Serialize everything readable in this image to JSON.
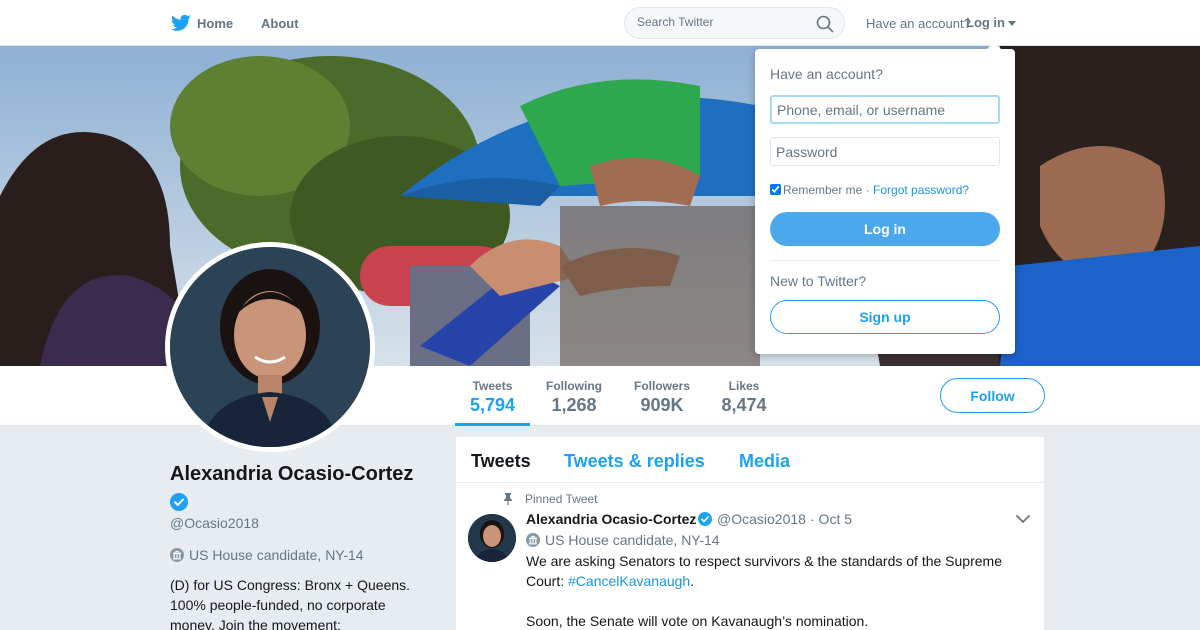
{
  "nav": {
    "home": "Home",
    "about": "About",
    "search_placeholder": "Search Twitter",
    "have_account": "Have an account?",
    "login": "Log in"
  },
  "stats": [
    {
      "label": "Tweets",
      "value": "5,794"
    },
    {
      "label": "Following",
      "value": "1,268"
    },
    {
      "label": "Followers",
      "value": "909K"
    },
    {
      "label": "Likes",
      "value": "8,474"
    }
  ],
  "follow_label": "Follow",
  "profile": {
    "name": "Alexandria Ocasio-Cortez",
    "handle": "@Ocasio2018",
    "location": "US House candidate, NY-14",
    "bio": "(D) for US Congress: Bronx + Queens. 100% people-funded, no corporate money. Join the movement:"
  },
  "tabs": [
    "Tweets",
    "Tweets & replies",
    "Media"
  ],
  "tweet": {
    "pinned_label": "Pinned Tweet",
    "name": "Alexandria Ocasio-Cortez",
    "handle": "@Ocasio2018",
    "date": "· Oct 5",
    "location": "US House candidate, NY-14",
    "text": "We are asking Senators to respect survivors & the standards of the Supreme Court:",
    "hashtag": "#CancelKavanaugh",
    "text_end": ".",
    "text2": "Soon, the Senate will vote on Kavanaugh’s nomination."
  },
  "login_dropdown": {
    "title": "Have an account?",
    "username_placeholder": "Phone, email, or username",
    "password_placeholder": "Password",
    "remember": "Remember me",
    "separator": " · ",
    "forgot": "Forgot password?",
    "login_button": "Log in",
    "new_label": "New to Twitter?",
    "signup_button": "Sign up"
  },
  "colors": {
    "accent": "#1da1f2",
    "login_button": "#4ca8ed",
    "background": "#e6ecf0"
  }
}
